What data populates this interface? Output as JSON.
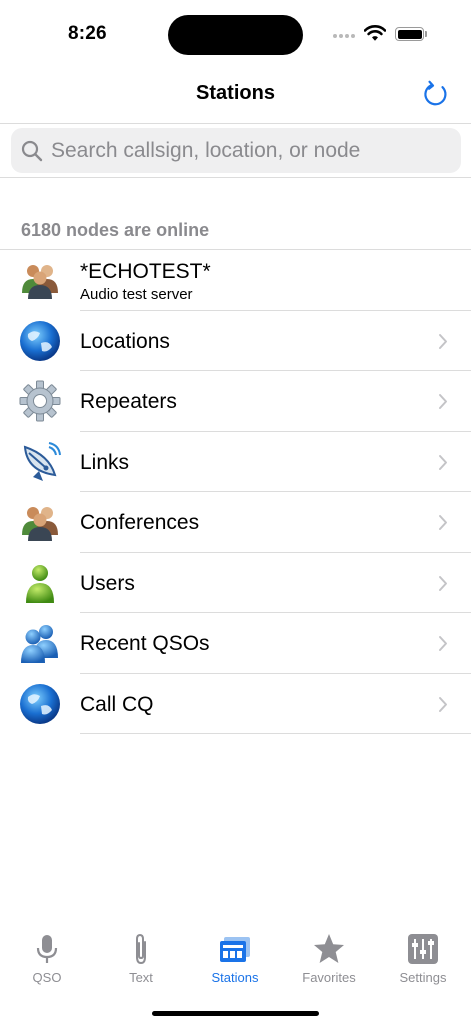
{
  "status_bar": {
    "time": "8:26"
  },
  "nav": {
    "title": "Stations"
  },
  "search": {
    "placeholder": "Search callsign, location, or node"
  },
  "section": {
    "header": "6180 nodes are online"
  },
  "list": {
    "echotest": {
      "title": "*ECHOTEST*",
      "subtitle": "Audio test server",
      "icon": "conference-people-icon"
    },
    "items": [
      {
        "label": "Locations",
        "icon": "globe-icon"
      },
      {
        "label": "Repeaters",
        "icon": "gear-icon"
      },
      {
        "label": "Links",
        "icon": "satellite-dish-icon"
      },
      {
        "label": "Conferences",
        "icon": "conference-people-icon"
      },
      {
        "label": "Users",
        "icon": "user-icon"
      },
      {
        "label": "Recent QSOs",
        "icon": "users-icon"
      },
      {
        "label": "Call CQ",
        "icon": "globe-icon"
      }
    ]
  },
  "tabs": [
    {
      "label": "QSO",
      "icon": "microphone-icon"
    },
    {
      "label": "Text",
      "icon": "paperclip-icon"
    },
    {
      "label": "Stations",
      "icon": "stations-icon",
      "active": true
    },
    {
      "label": "Favorites",
      "icon": "star-icon"
    },
    {
      "label": "Settings",
      "icon": "sliders-icon"
    }
  ],
  "colors": {
    "accent": "#1a73e8",
    "separator": "#dcdcdc",
    "secondary_text": "#8a8a8e",
    "search_bg": "#efeff0"
  }
}
